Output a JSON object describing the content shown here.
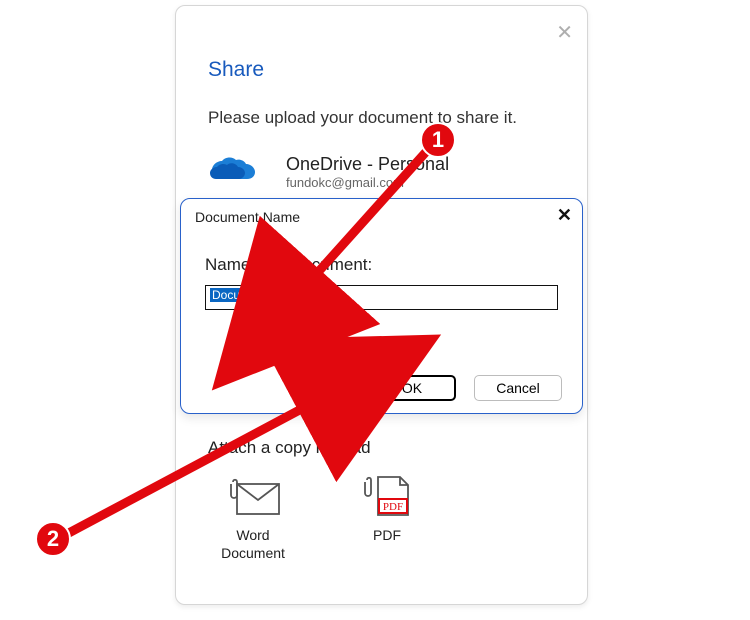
{
  "panel": {
    "title": "Share",
    "description": "Please upload your document to share it.",
    "close_label": "✕"
  },
  "onedrive": {
    "title": "OneDrive - Personal",
    "email": "fundokc@gmail.com"
  },
  "attach": {
    "title": "Attach a copy instead",
    "items": [
      {
        "label": "Word Document"
      },
      {
        "label": "PDF"
      }
    ]
  },
  "dialog": {
    "title": "Document Name",
    "close_label": "✕",
    "field_label": "Name your document:",
    "input_value": "Document1",
    "ok_label": "OK",
    "cancel_label": "Cancel"
  },
  "callouts": {
    "one": "1",
    "two": "2"
  }
}
